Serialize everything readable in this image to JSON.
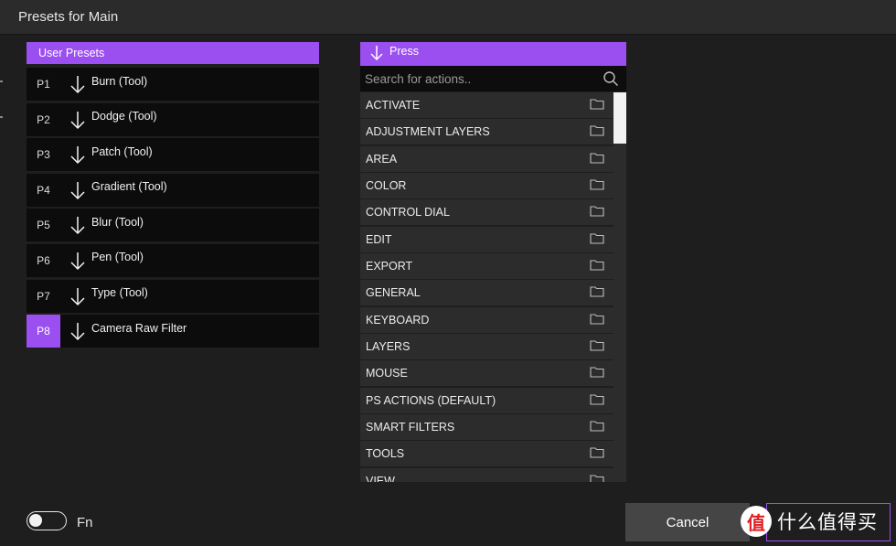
{
  "window": {
    "title": "Presets for Main"
  },
  "presets": {
    "header": "User Presets",
    "items": [
      {
        "num": "P1",
        "label": "Burn (Tool)",
        "selected": false
      },
      {
        "num": "P2",
        "label": "Dodge (Tool)",
        "selected": false
      },
      {
        "num": "P3",
        "label": "Patch (Tool)",
        "selected": false
      },
      {
        "num": "P4",
        "label": "Gradient (Tool)",
        "selected": false
      },
      {
        "num": "P5",
        "label": "Blur (Tool)",
        "selected": false
      },
      {
        "num": "P6",
        "label": "Pen (Tool)",
        "selected": false
      },
      {
        "num": "P7",
        "label": "Type (Tool)",
        "selected": false
      },
      {
        "num": "P8",
        "label": "Camera Raw Filter",
        "selected": true
      }
    ]
  },
  "actions": {
    "header": "Press",
    "search": {
      "placeholder": "Search for actions..",
      "value": ""
    },
    "categories": [
      "ACTIVATE",
      "ADJUSTMENT LAYERS",
      "AREA",
      "COLOR",
      "CONTROL DIAL",
      "EDIT",
      "EXPORT",
      "GENERAL",
      "KEYBOARD",
      "LAYERS",
      "MOUSE",
      "PS ACTIONS (DEFAULT)",
      "SMART FILTERS",
      "TOOLS",
      "VIEW"
    ]
  },
  "footer": {
    "fn_label": "Fn",
    "fn_enabled": false,
    "cancel_label": "Cancel"
  },
  "watermark": {
    "logo": "值",
    "text": "什么值得买"
  },
  "colors": {
    "accent": "#9b4ff0",
    "background": "#1e1e1e",
    "row": "#2c2c2c",
    "preset_row": "#0c0c0c"
  }
}
